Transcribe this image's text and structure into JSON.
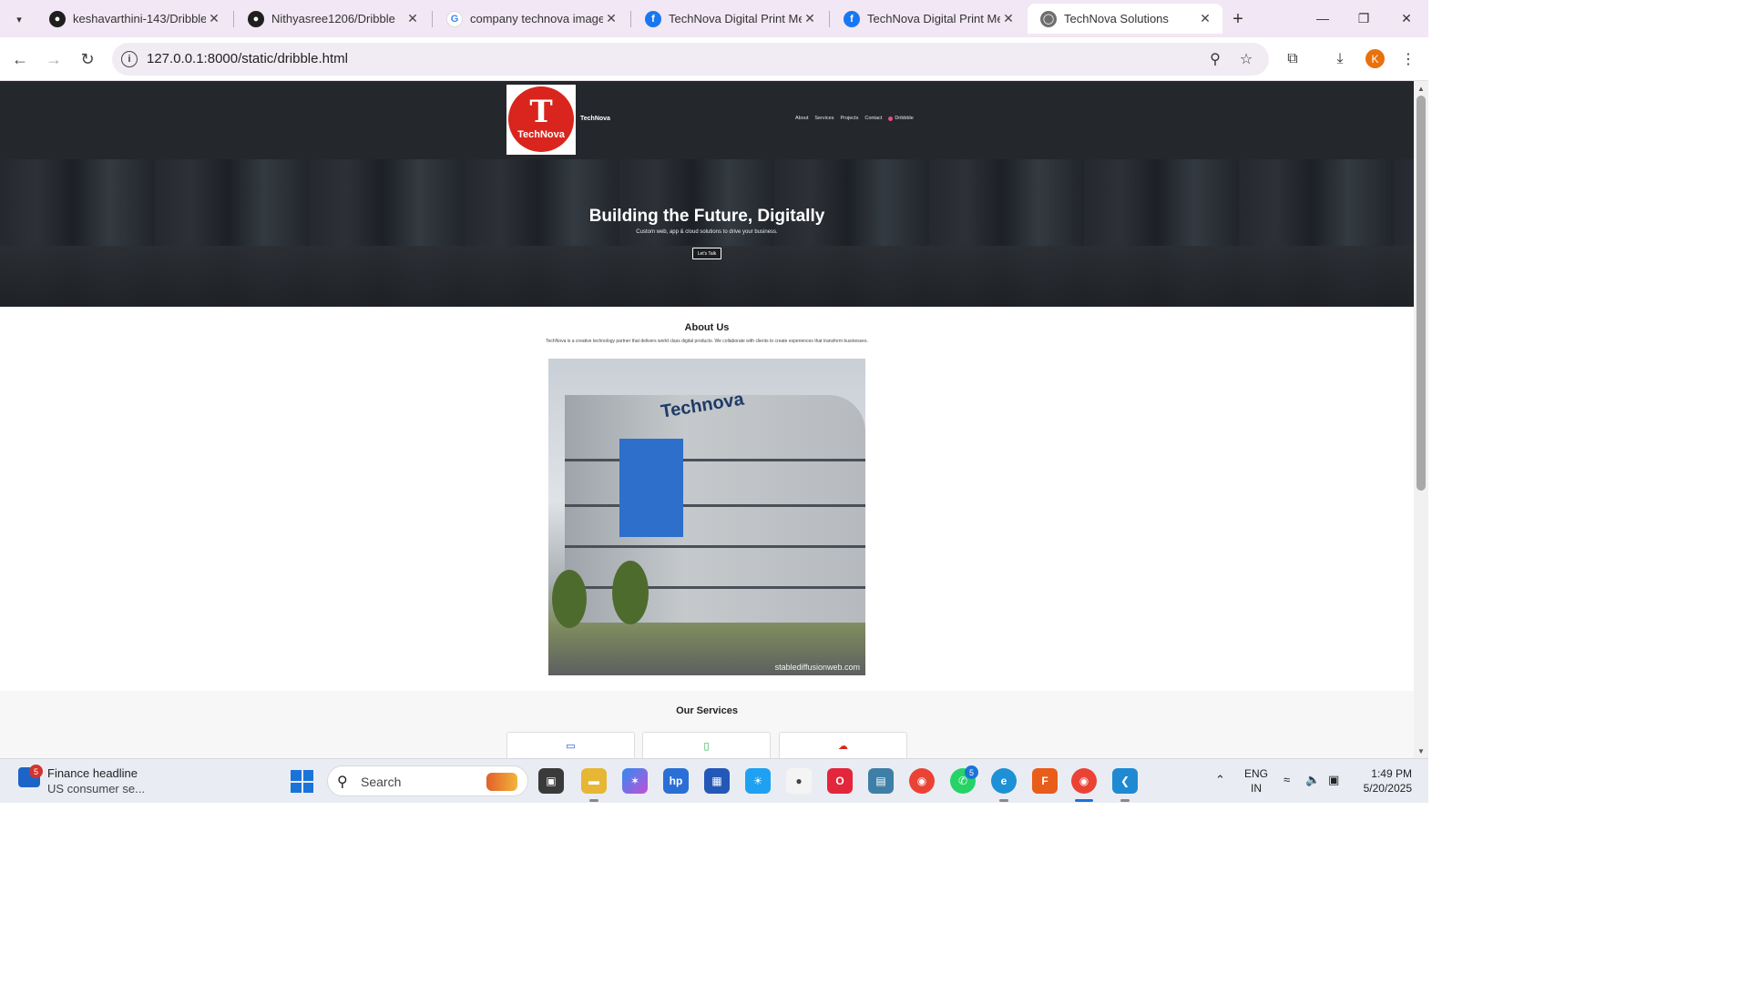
{
  "browser": {
    "tabs": [
      {
        "title": "keshavarthini-143/Dribble",
        "icon": "github-icon"
      },
      {
        "title": "Nithyasree1206/Dribble",
        "icon": "github-icon"
      },
      {
        "title": "company technova image",
        "icon": "google-icon"
      },
      {
        "title": "TechNova Digital Print Med",
        "icon": "facebook-icon"
      },
      {
        "title": "TechNova Digital Print Med",
        "icon": "facebook-icon"
      },
      {
        "title": "TechNova Solutions",
        "icon": "globe-icon"
      }
    ],
    "active_tab": 5,
    "url": "127.0.0.1:8000/static/dribble.html",
    "profile_initial": "K",
    "accent": "#f2e7f4"
  },
  "site": {
    "logo_text": "TechNova",
    "brand": "TechNova",
    "nav": [
      "About",
      "Services",
      "Projects",
      "Contact",
      "Dribbble"
    ],
    "hero": {
      "title": "Building the Future, Digitally",
      "subtitle": "Custom web, app & cloud solutions to drive your business.",
      "button": "Let's Talk"
    },
    "about": {
      "title": "About Us",
      "text": "TechNova is a creative technology partner that delivers world class digital products. We collaborate with clients to create experiences that transform businesses.",
      "image_sign": "Technova",
      "image_watermark": "stablediffusionweb.com"
    },
    "services": {
      "title": "Our Services",
      "cards": [
        {
          "icon": "laptop-icon",
          "color": "#1a56c7"
        },
        {
          "icon": "mobile-icon",
          "color": "#2aa84a"
        },
        {
          "icon": "cloud-upload-icon",
          "color": "#d9251d"
        }
      ]
    },
    "colors": {
      "header": "#24272c",
      "logo_red": "#d9251d"
    }
  },
  "taskbar": {
    "widget_badge": "5",
    "news_title": "Finance headline",
    "news_sub": "US consumer se...",
    "search_label": "Search",
    "whatsapp_badge": "5",
    "lang_line1": "ENG",
    "lang_line2": "IN",
    "time": "1:49 PM",
    "date": "5/20/2025"
  }
}
